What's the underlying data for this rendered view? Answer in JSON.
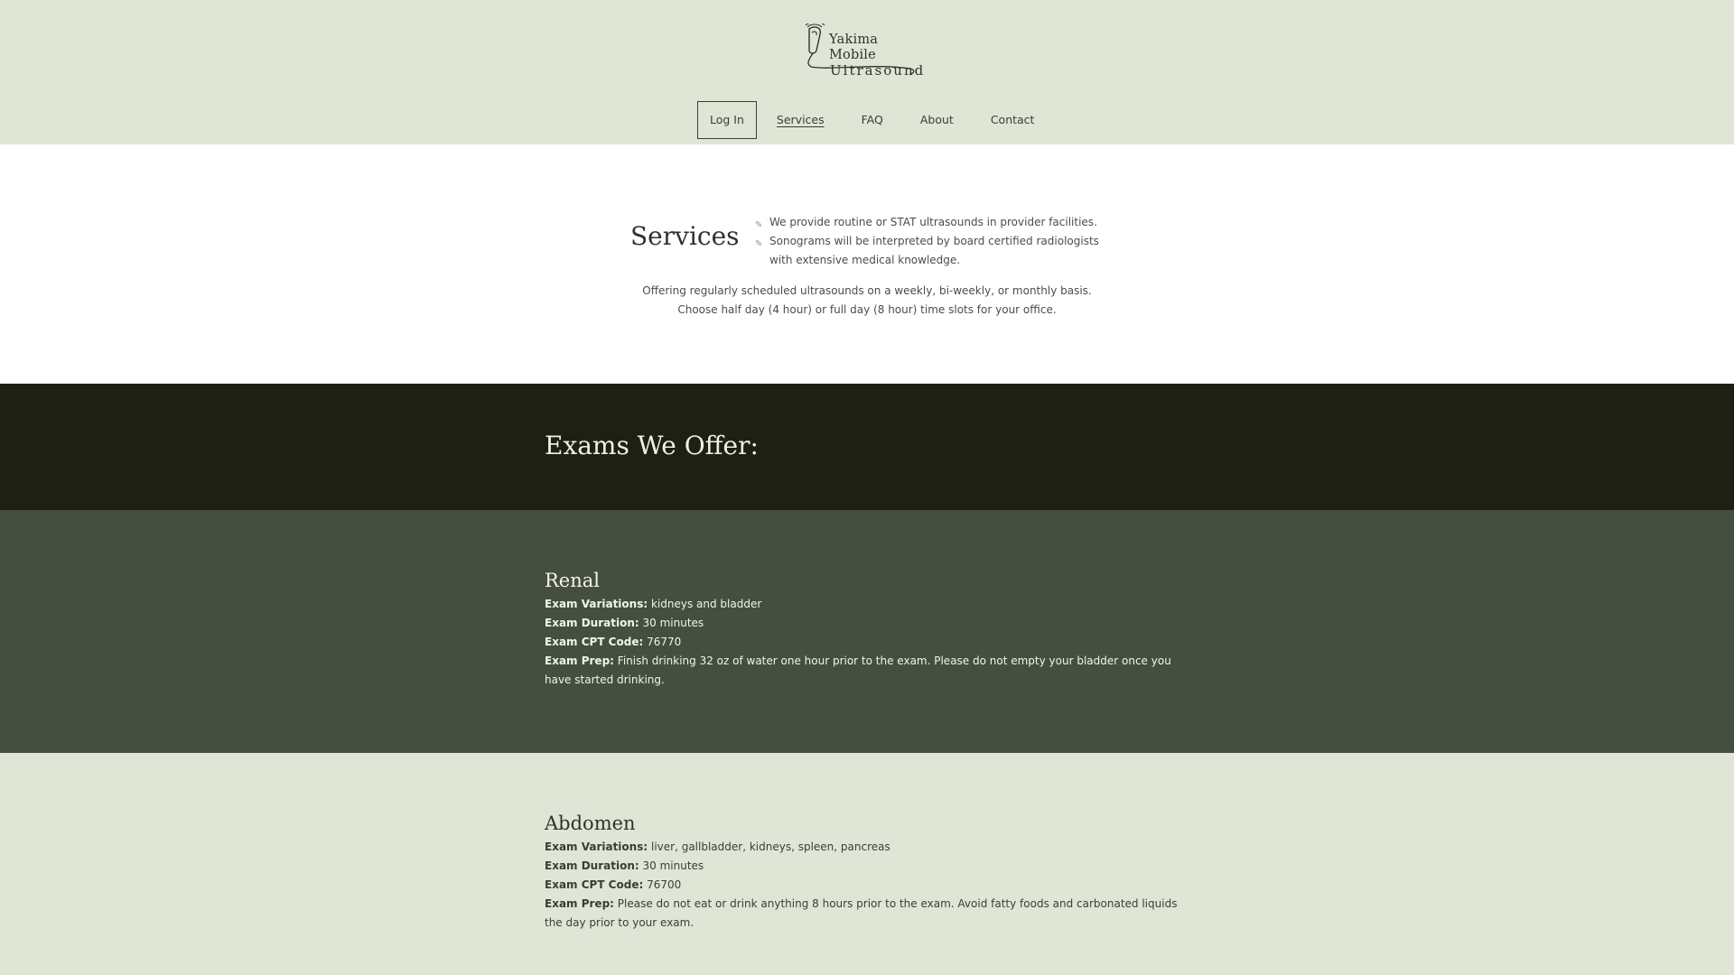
{
  "header": {
    "logo": {
      "line1": "Yakima Mobile",
      "line2": "Ultrasound"
    },
    "nav": {
      "login": "Log In",
      "services": "Services",
      "faq": "FAQ",
      "about": "About",
      "contact": "Contact"
    }
  },
  "intro": {
    "title": "Services",
    "bullets": [
      "We provide routine or STAT ultrasounds in provider facilities.",
      "Sonograms will be interpreted by board certified radiologists with extensive medical knowledge."
    ],
    "para_line1": "Offering regularly scheduled ultrasounds on a weekly, bi-weekly, or monthly basis.",
    "para_line2": "Choose half day (4 hour) or full day (8 hour) time slots for your office."
  },
  "exams_heading": "Exams We Offer:",
  "exams": [
    {
      "title": "Renal",
      "variations_label": "Exam Variations:",
      "variations": "kidneys and bladder",
      "duration_label": "Exam Duration:",
      "duration": "30 minutes",
      "cpt_label": "Exam CPT Code:",
      "cpt": "76770",
      "prep_label": "Exam Prep:",
      "prep": "Finish drinking 32 oz of water one hour prior to the exam. Please do not empty your bladder once you have started drinking."
    },
    {
      "title": "Abdomen",
      "variations_label": "Exam Variations:",
      "variations": "liver, gallbladder, kidneys, spleen, pancreas",
      "duration_label": "Exam Duration:",
      "duration": "30 minutes",
      "cpt_label": "Exam CPT Code:",
      "cpt": "76700",
      "prep_label": "Exam Prep:",
      "prep": "Please do not eat or drink anything 8 hours prior to the exam. Avoid fatty foods and carbonated liquids the day prior to your exam."
    }
  ],
  "icons": {
    "bullet": "pen-nib-icon",
    "logo": "ultrasound-probe-icon"
  },
  "colors": {
    "header_bg": "#dfe6d6",
    "dark_band": "#1e2014",
    "renal_bg": "#444f3f",
    "abdomen_bg": "#dfe6d6"
  }
}
